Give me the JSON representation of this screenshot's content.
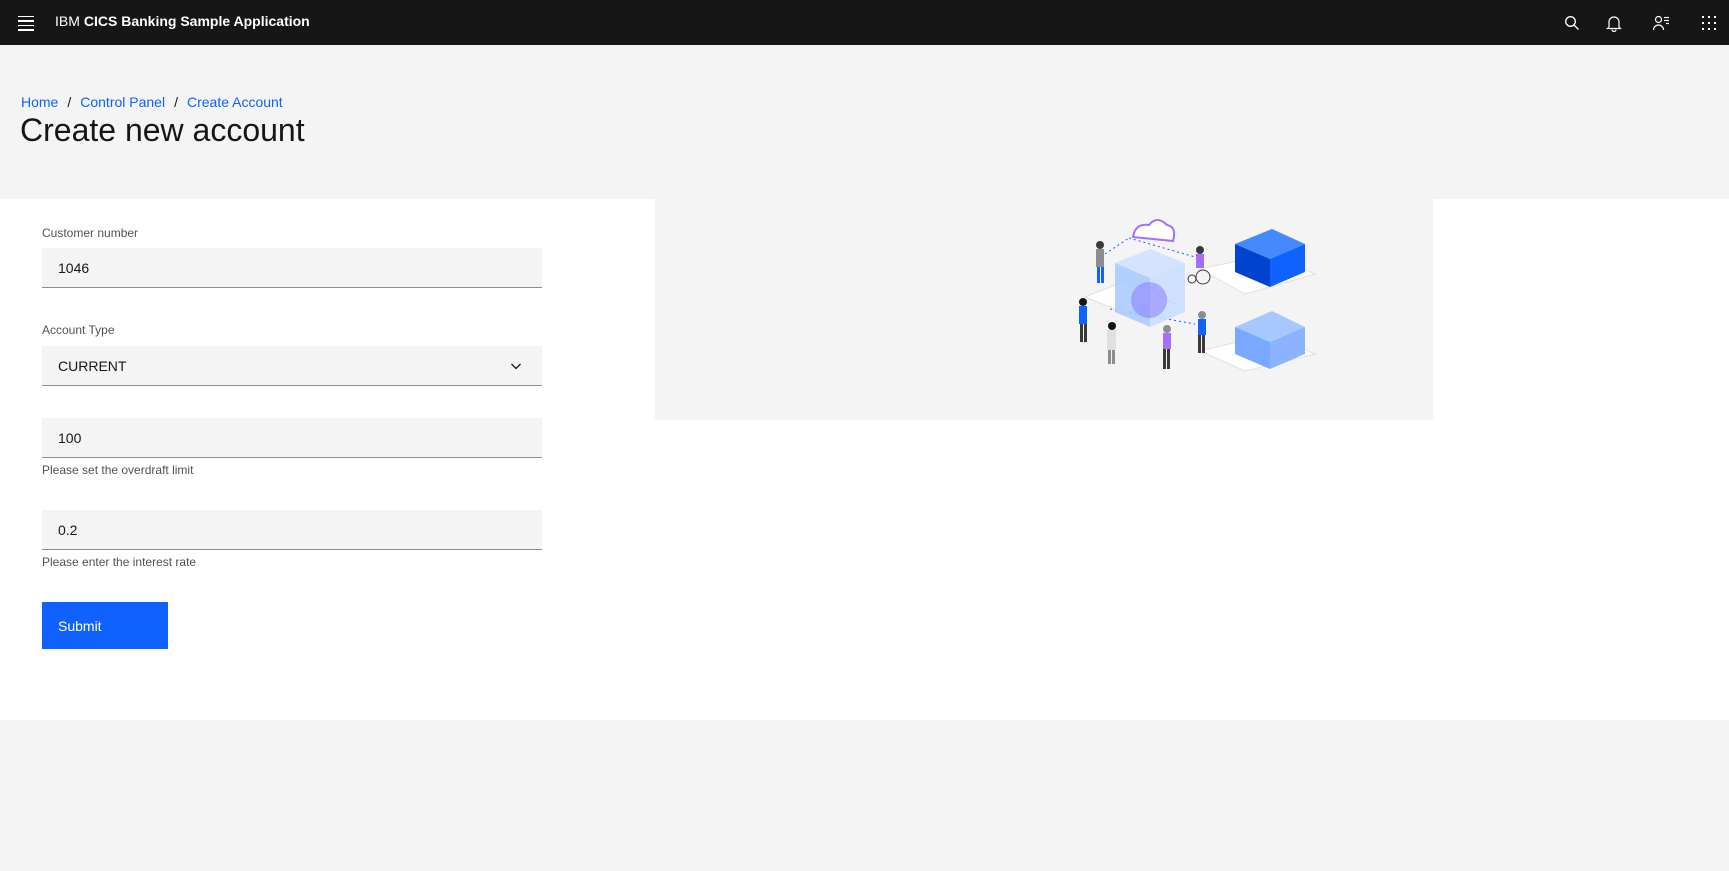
{
  "header": {
    "prefix": "IBM",
    "app_name": "CICS Banking Sample Application",
    "icons": [
      "menu-icon",
      "search-icon",
      "notification-icon",
      "user-icon",
      "app-switcher-icon"
    ]
  },
  "breadcrumb": {
    "items": [
      "Home",
      "Control Panel",
      "Create Account"
    ],
    "separator": "/"
  },
  "page": {
    "title": "Create new account"
  },
  "form": {
    "customer_number": {
      "label": "Customer number",
      "value": "1046"
    },
    "account_type": {
      "label": "Account Type",
      "value": "CURRENT"
    },
    "overdraft": {
      "value": "100",
      "helper": "Please set the overdraft limit"
    },
    "interest": {
      "value": "0.2",
      "helper": "Please enter the interest rate"
    },
    "submit_label": "Submit"
  },
  "illustration": {
    "name": "cloud-data-illustration"
  },
  "colors": {
    "accent": "#0f62fe",
    "header_bg": "#161616",
    "page_bg": "#f4f4f4"
  }
}
